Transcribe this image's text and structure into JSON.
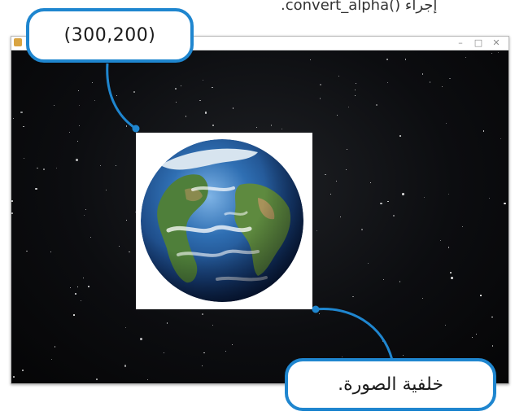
{
  "caption_top": ".convert_alpha() إجراء",
  "window": {
    "controls": {
      "minimize": "–",
      "maximize": "□",
      "close": "✕"
    }
  },
  "callouts": {
    "coordinate_label": "(300,200)",
    "background_label": "خلفية الصورة."
  },
  "icons": [
    "app-icon",
    "earth-image",
    "minimize-icon",
    "maximize-icon",
    "close-icon"
  ],
  "colors": {
    "accent": "#1f86cf",
    "space": "#0c0d10",
    "sprite_bg": "#ffffff"
  }
}
